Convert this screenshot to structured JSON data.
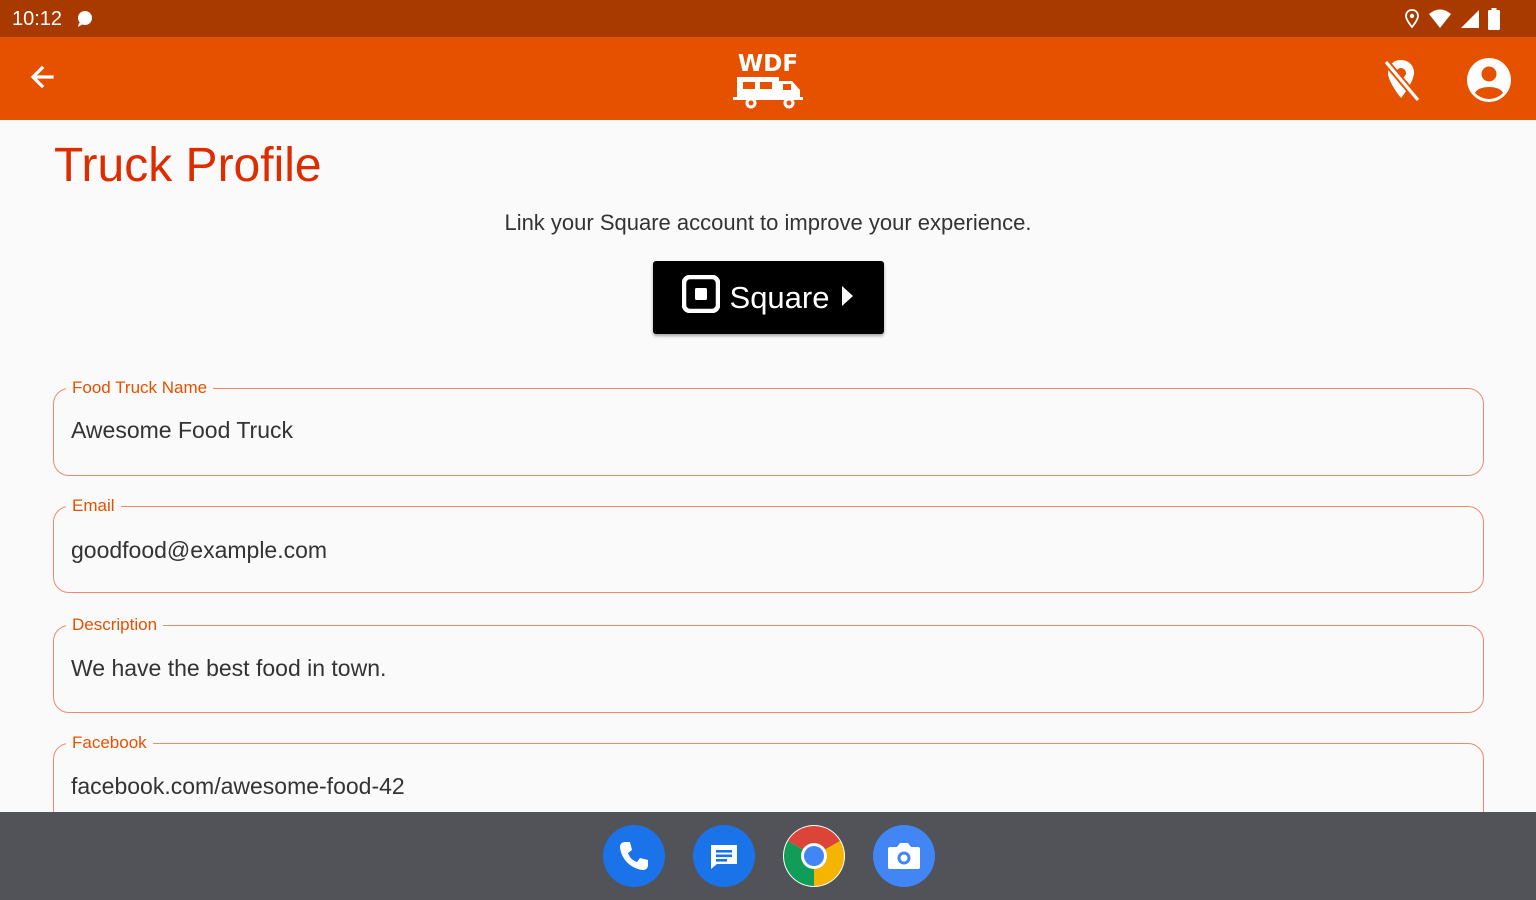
{
  "status_bar": {
    "time": "10:12",
    "icons": [
      "chat-icon",
      "location-icon",
      "wifi-icon",
      "signal-icon",
      "battery-icon"
    ]
  },
  "app_bar": {
    "logo_text": "WDF",
    "icons": [
      "back-arrow-icon",
      "location-off-icon",
      "account-icon"
    ]
  },
  "page": {
    "title": "Truck Profile",
    "square_prompt": "Link your Square account to improve your experience.",
    "square_button_label": "Square"
  },
  "form": {
    "fields": [
      {
        "label": "Food Truck Name",
        "value": "Awesome Food Truck"
      },
      {
        "label": "Email",
        "value": "goodfood@example.com"
      },
      {
        "label": "Description",
        "value": "We have the best food in town."
      },
      {
        "label": "Facebook",
        "value": "facebook.com/awesome-food-42"
      }
    ]
  },
  "dock": {
    "apps": [
      "phone-icon",
      "messages-icon",
      "chrome-icon",
      "camera-icon"
    ]
  },
  "colors": {
    "status_bar": "#a83a00",
    "app_bar": "#e65100",
    "title": "#dd2c00",
    "field_border": "#ef8a70",
    "nav_bar": "#525259"
  }
}
